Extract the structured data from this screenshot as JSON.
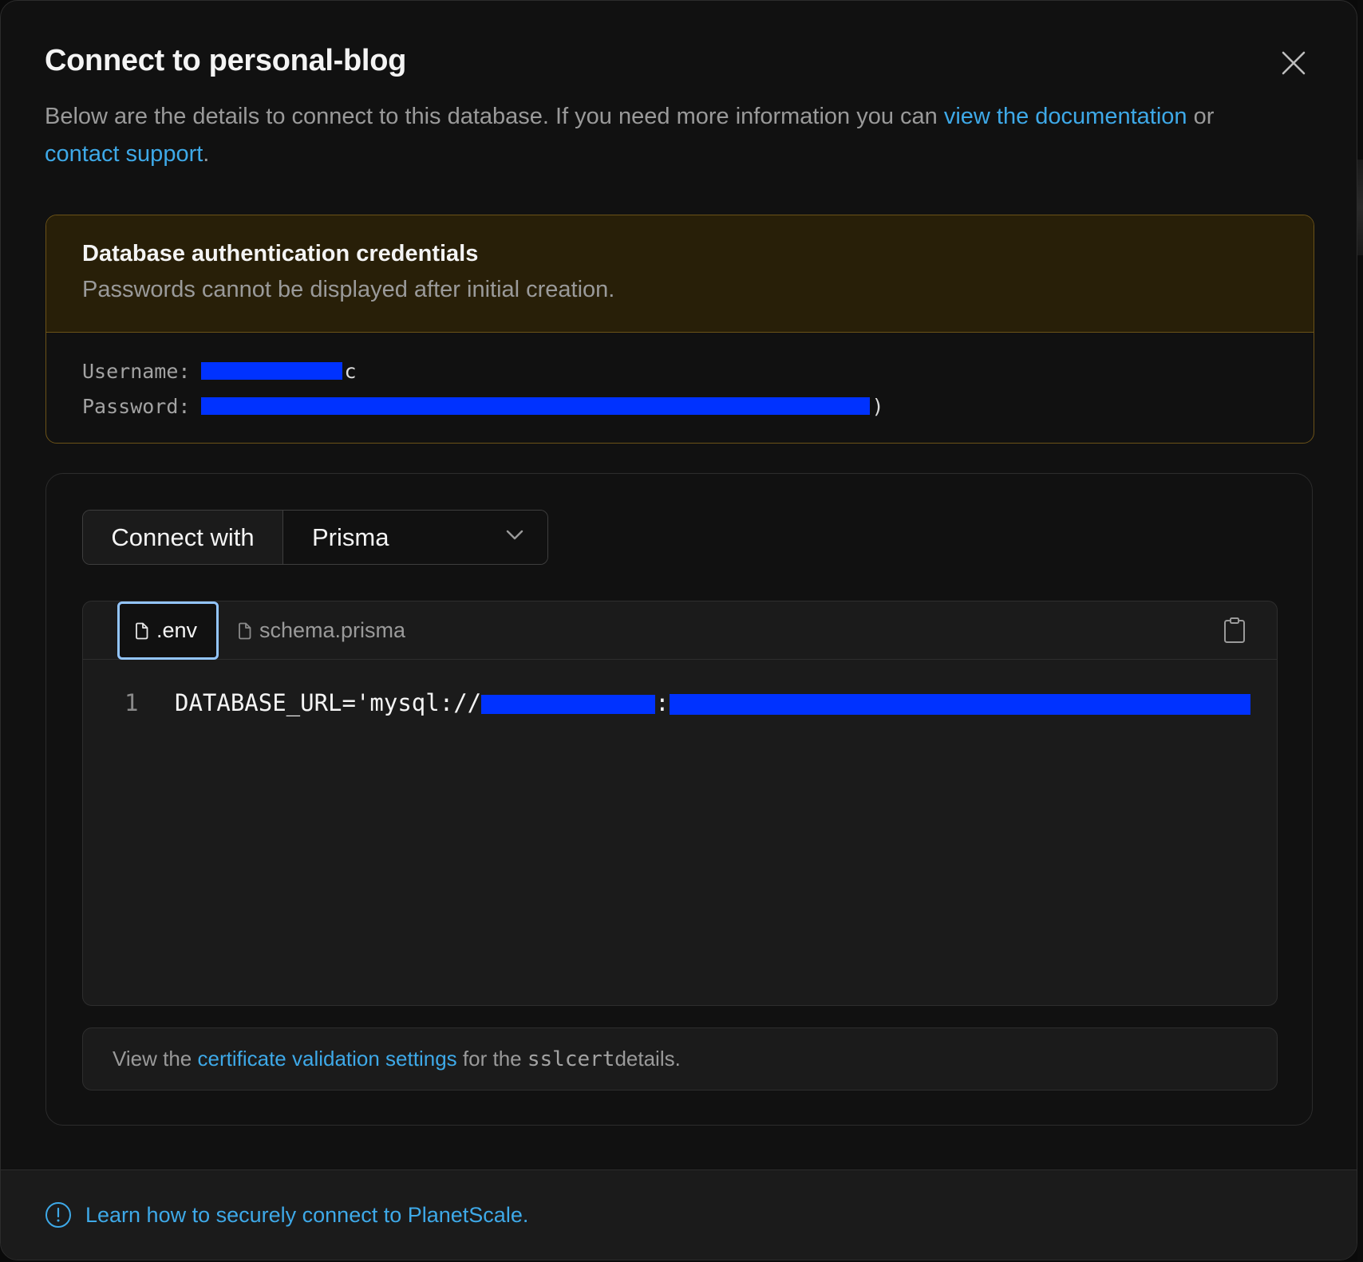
{
  "modal": {
    "title": "Connect to personal-blog",
    "description": {
      "text_before": "Below are the details to connect to this database. If you need more information you can ",
      "docs_link": "view the documentation",
      "middle": " or ",
      "support_link": "contact support",
      "end": "."
    },
    "close_icon": "close-icon"
  },
  "credentials": {
    "title": "Database authentication credentials",
    "subtitle": "Passwords cannot be displayed after initial creation.",
    "username_label": "Username:",
    "username_value": "[redacted]",
    "username_visible_tail": "c",
    "password_label": "Password:",
    "password_value": "[redacted]",
    "password_visible_tail": ")"
  },
  "connect": {
    "label": "Connect with",
    "selected": "Prisma",
    "tabs": [
      {
        "label": ".env",
        "icon": "file-icon",
        "active": true
      },
      {
        "label": "schema.prisma",
        "icon": "file-icon",
        "active": false
      }
    ],
    "copy_icon": "clipboard-icon",
    "code_lines": [
      {
        "number": "1",
        "prefix": "DATABASE_URL='mysql://",
        "user": "[redacted]",
        "sep": ":",
        "password": "[redacted]"
      }
    ],
    "info": {
      "before": "View the ",
      "link": "certificate validation settings",
      "middle": " for the ",
      "code": "sslcert",
      "end": " details."
    }
  },
  "footer": {
    "icon": "alert-circle-icon",
    "link": "Learn how to securely connect to PlanetScale."
  },
  "colors": {
    "accent_link": "#3ea9e8",
    "warning_border": "#6b5218",
    "warning_bg": "#281f08",
    "tab_focus": "#93c5fd",
    "redaction": "#0032ff"
  }
}
